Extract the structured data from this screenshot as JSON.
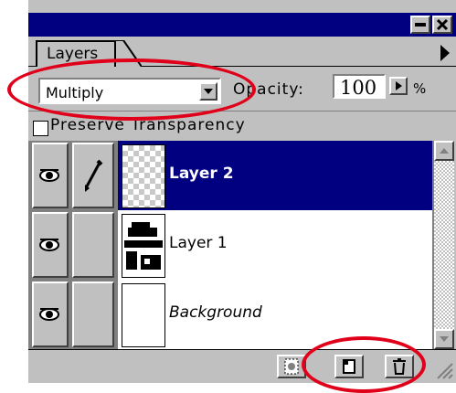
{
  "panel": {
    "tab_label": "Layers",
    "blend_mode": "Multiply",
    "opacity_label": "Opacity:",
    "opacity_value": "100",
    "opacity_unit": "%",
    "preserve_transparency_label": "Preserve Transparency",
    "preserve_transparency_checked": false
  },
  "layers": [
    {
      "name": "Layer 2",
      "selected": true,
      "visible": true,
      "brush": true,
      "thumb": "transparent-checker"
    },
    {
      "name": "Layer 1",
      "selected": false,
      "visible": true,
      "brush": false,
      "thumb": "bw-photo"
    },
    {
      "name": "Background",
      "selected": false,
      "visible": true,
      "brush": false,
      "thumb": "white",
      "italic": true
    }
  ],
  "colors": {
    "title_bar": "#000080",
    "selected_row": "#000080",
    "panel_bg": "#c0c0c0",
    "annotation": "#e0001a"
  },
  "icons": {
    "eye": "eye-icon",
    "brush": "brush-icon",
    "mask": "mask-icon",
    "new_layer": "new-layer-icon",
    "trash": "trash-icon",
    "minimize": "minimize-icon",
    "close": "close-icon",
    "menu_arrow": "panel-menu-arrow-icon"
  }
}
